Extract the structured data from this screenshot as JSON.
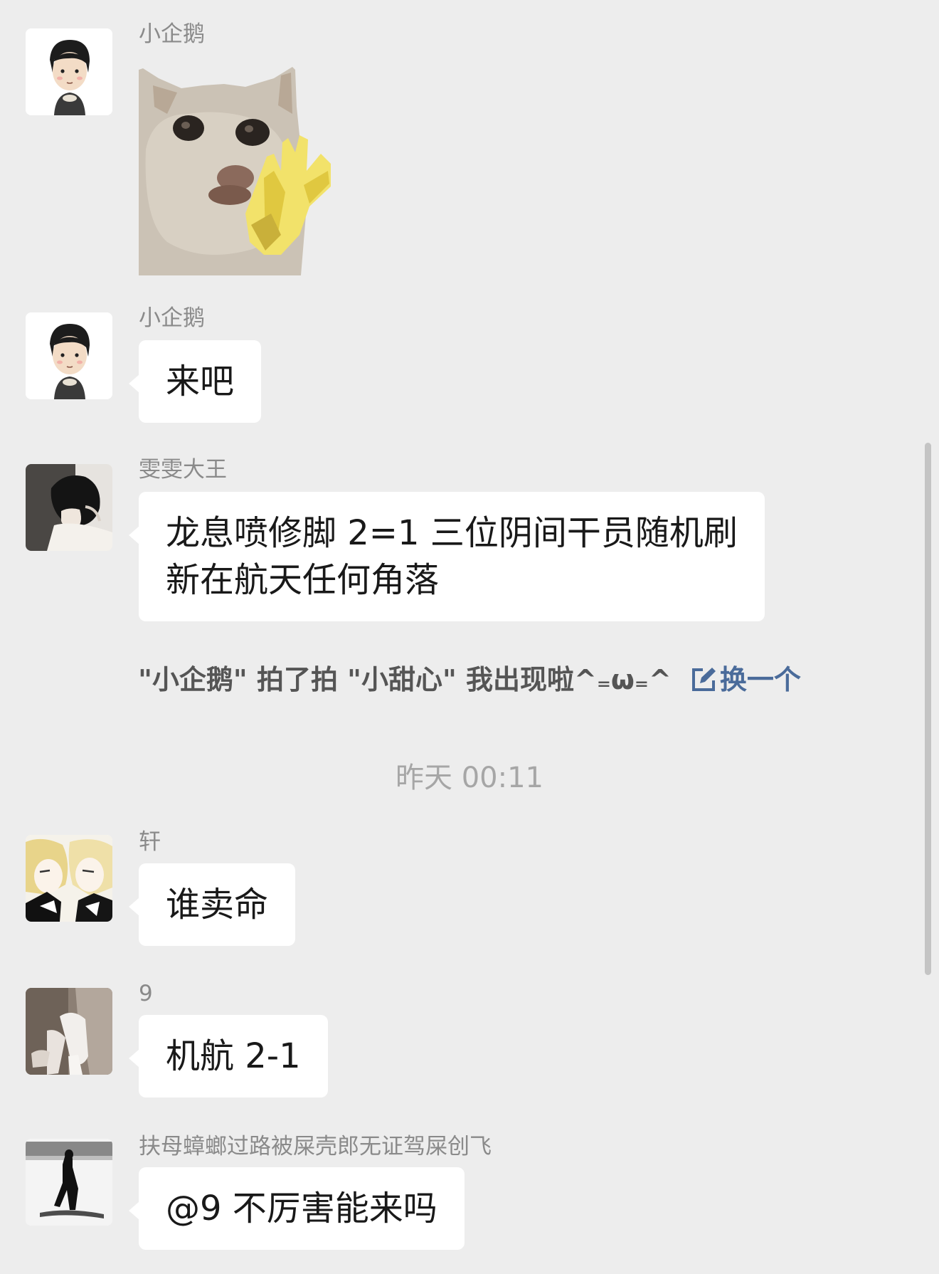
{
  "messages": [
    {
      "sender": "小企鹅",
      "avatar": "boy-cartoon-avatar",
      "type": "sticker",
      "sticker": "cat-waving-yellow-hand-sticker"
    },
    {
      "sender": "小企鹅",
      "avatar": "boy-cartoon-avatar",
      "type": "text",
      "text": "来吧"
    },
    {
      "sender": "雯雯大王",
      "avatar": "dark-hair-person-avatar",
      "type": "text",
      "line1": "龙息喷修脚 2=1 三位阴间干员随机刷",
      "line2": "新在航天任何角落"
    },
    {
      "sender": "轩",
      "avatar": "anime-pair-avatar",
      "type": "text",
      "text": "谁卖命"
    },
    {
      "sender": "9",
      "avatar": "legs-photo-avatar",
      "type": "text",
      "text": "机航 2-1"
    },
    {
      "sender": "扶母蟑螂过路被屎壳郎无证驾屎创飞",
      "avatar": "silhouette-figure-avatar",
      "type": "text",
      "text": "@9 不厉害能来吗"
    }
  ],
  "system_notice": {
    "text": "\"小企鹅\" 拍了拍 \"小甜心\" 我出现啦^₌ω₌^",
    "action_label": "换一个",
    "action_icon": "edit-icon"
  },
  "timestamp": "昨天 00:11",
  "colors": {
    "background": "#ededed",
    "bubble": "#ffffff",
    "link": "#4a6b9a"
  }
}
